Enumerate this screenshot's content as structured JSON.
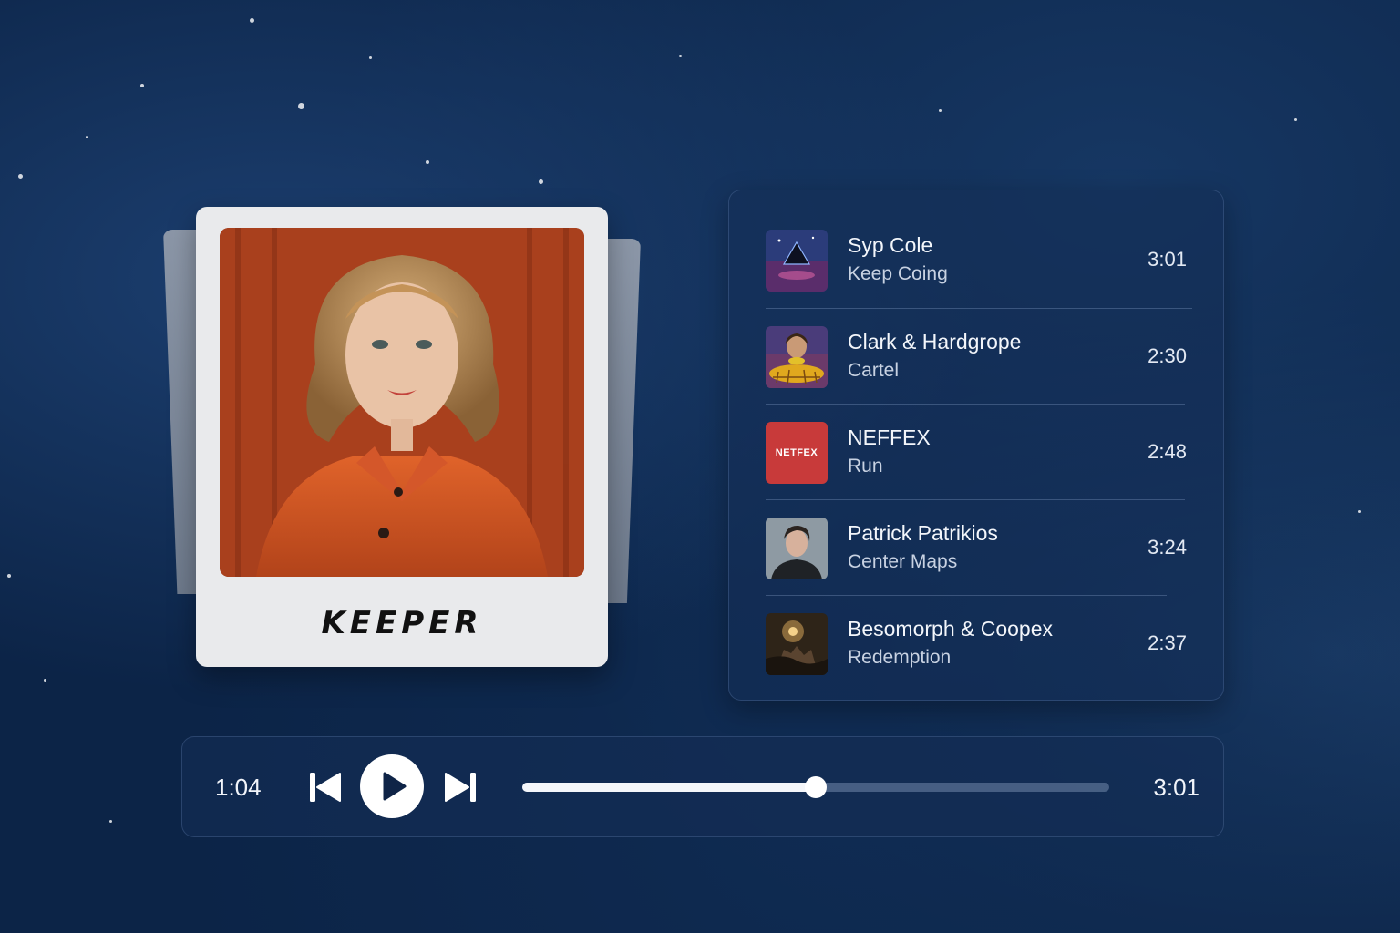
{
  "album": {
    "title": "KEEPER",
    "cover_icon": "portrait-photo"
  },
  "playlist": {
    "tracks": [
      {
        "artist": "Syp Cole",
        "song": "Keep Coing",
        "duration": "3:01",
        "thumb": "space-pyramid-art"
      },
      {
        "artist": "Clark & Hardgrope",
        "song": "Cartel",
        "duration": "2:30",
        "thumb": "retro-figure-art"
      },
      {
        "artist": "NEFFEX",
        "song": "Run",
        "duration": "2:48",
        "thumb": "neffex-logo",
        "thumb_text": "NETFEX"
      },
      {
        "artist": "Patrick Patrikios",
        "song": "Center Maps",
        "duration": "3:24",
        "thumb": "portrait-photo"
      },
      {
        "artist": "Besomorph & Coopex",
        "song": "Redemption",
        "duration": "2:37",
        "thumb": "dark-scene-art"
      }
    ]
  },
  "player": {
    "current_time": "1:04",
    "total_time": "3:01",
    "progress": 0.5,
    "prev_icon": "skip-back-icon",
    "play_icon": "play-icon",
    "next_icon": "skip-forward-icon"
  },
  "colors": {
    "background": "#0c2447",
    "panel": "#142d55",
    "neffex_red": "#c83a3a",
    "card": "#e9eaec"
  }
}
